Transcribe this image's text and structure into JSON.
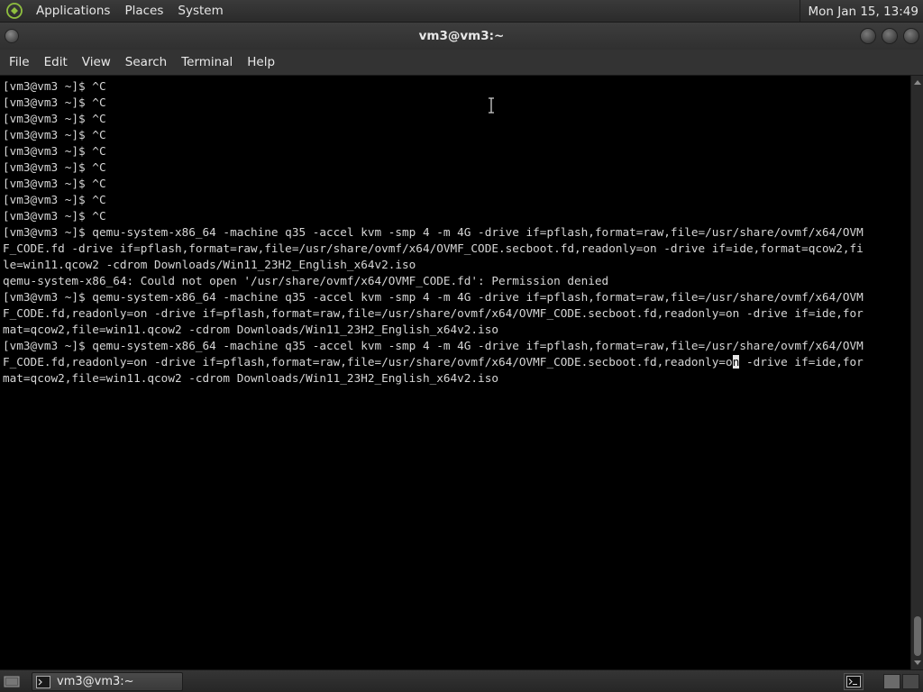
{
  "top_panel": {
    "menus": [
      "Applications",
      "Places",
      "System"
    ],
    "clock": "Mon Jan 15, 13:49"
  },
  "window": {
    "title": "vm3@vm3:~"
  },
  "menubar": {
    "items": [
      "File",
      "Edit",
      "View",
      "Search",
      "Terminal",
      "Help"
    ]
  },
  "terminal": {
    "lines": [
      "[vm3@vm3 ~]$ ^C",
      "[vm3@vm3 ~]$ ^C",
      "[vm3@vm3 ~]$ ^C",
      "[vm3@vm3 ~]$ ^C",
      "[vm3@vm3 ~]$ ^C",
      "[vm3@vm3 ~]$ ^C",
      "[vm3@vm3 ~]$ ^C",
      "[vm3@vm3 ~]$ ^C",
      "[vm3@vm3 ~]$ ^C",
      "[vm3@vm3 ~]$ qemu-system-x86_64 -machine q35 -accel kvm -smp 4 -m 4G -drive if=pflash,format=raw,file=/usr/share/ovmf/x64/OVM",
      "F_CODE.fd -drive if=pflash,format=raw,file=/usr/share/ovmf/x64/OVMF_CODE.secboot.fd,readonly=on -drive if=ide,format=qcow2,fi",
      "le=win11.qcow2 -cdrom Downloads/Win11_23H2_English_x64v2.iso",
      "qemu-system-x86_64: Could not open '/usr/share/ovmf/x64/OVMF_CODE.fd': Permission denied",
      "[vm3@vm3 ~]$ qemu-system-x86_64 -machine q35 -accel kvm -smp 4 -m 4G -drive if=pflash,format=raw,file=/usr/share/ovmf/x64/OVM",
      "F_CODE.fd,readonly=on -drive if=pflash,format=raw,file=/usr/share/ovmf/x64/OVMF_CODE.secboot.fd,readonly=on -drive if=ide,for",
      "mat=qcow2,file=win11.qcow2 -cdrom Downloads/Win11_23H2_English_x64v2.iso",
      "[vm3@vm3 ~]$ qemu-system-x86_64 -machine q35 -accel kvm -smp 4 -m 4G -drive if=pflash,format=raw,file=/usr/share/ovmf/x64/OVM"
    ],
    "cursor_line": {
      "before": "F_CODE.fd,readonly=on -drive if=pflash,format=raw,file=/usr/share/ovmf/x64/OVMF_CODE.secboot.fd,readonly=o",
      "cursor": "n",
      "after": " -drive if=ide,for"
    },
    "last_line": "mat=qcow2,file=win11.qcow2 -cdrom Downloads/Win11_23H2_English_x64v2.iso"
  },
  "taskbar": {
    "task_label": "vm3@vm3:~"
  },
  "icons": {
    "panel_logo": "mate-logo-icon",
    "task": "terminal-icon",
    "show_desktop": "show-desktop-icon",
    "tray": "terminal-tray-icon"
  },
  "colors": {
    "terminal_bg": "#000000",
    "terminal_fg": "#d6d6d6",
    "panel_bg": "#2f2f2f"
  }
}
